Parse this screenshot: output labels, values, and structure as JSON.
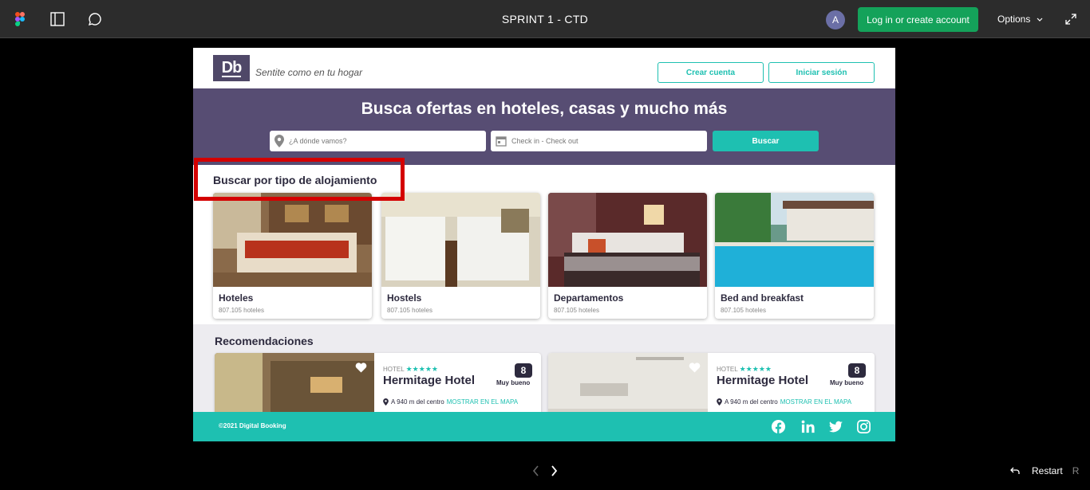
{
  "figma_bar": {
    "title": "SPRINT 1 - CTD",
    "avatar_initial": "A",
    "login_label": "Log in or create account",
    "options_label": "Options",
    "icons": [
      "figma-logo-icon",
      "sidebar-icon",
      "comment-icon",
      "chevron-down-icon",
      "expand-icon"
    ]
  },
  "site": {
    "logo": "Db",
    "tagline": "Sentite como en tu hogar",
    "create_account": "Crear cuenta",
    "sign_in": "Iniciar sesión",
    "hero_title": "Busca ofertas en hoteles, casas y mucho más",
    "destination_placeholder": "¿A dónde vamos?",
    "dates_placeholder": "Check in - Check out",
    "search_button": "Buscar",
    "category_title": "Buscar por tipo de alojamiento",
    "categories": [
      {
        "name": "Hoteles",
        "count": "807.105 hoteles"
      },
      {
        "name": "Hostels",
        "count": "807.105 hoteles"
      },
      {
        "name": "Departamentos",
        "count": "807.105 hoteles"
      },
      {
        "name": "Bed and breakfast",
        "count": "807.105 hoteles"
      }
    ],
    "recommendations_title": "Recomendaciones",
    "recommendations": [
      {
        "kind": "HOTEL",
        "stars": "★★★★★",
        "name": "Hermitage Hotel",
        "score": "8",
        "rating": "Muy bueno",
        "distance": "A 940 m del centro",
        "map_link": "MOSTRAR EN EL MAPA"
      },
      {
        "kind": "HOTEL",
        "stars": "★★★★★",
        "name": "Hermitage Hotel",
        "score": "8",
        "rating": "Muy bueno",
        "distance": "A 940 m del centro",
        "map_link": "MOSTRAR EN EL MAPA"
      }
    ],
    "footer_copy": "©2021 Digital Booking",
    "social_icons": [
      "facebook-icon",
      "linkedin-icon",
      "twitter-icon",
      "instagram-icon"
    ]
  },
  "player": {
    "restart_label": "Restart",
    "restart_key": "R"
  },
  "colors": {
    "accent": "#1ec0b1",
    "brand": "#574d73",
    "figma_green": "#14a25a",
    "highlight": "#d40000"
  }
}
